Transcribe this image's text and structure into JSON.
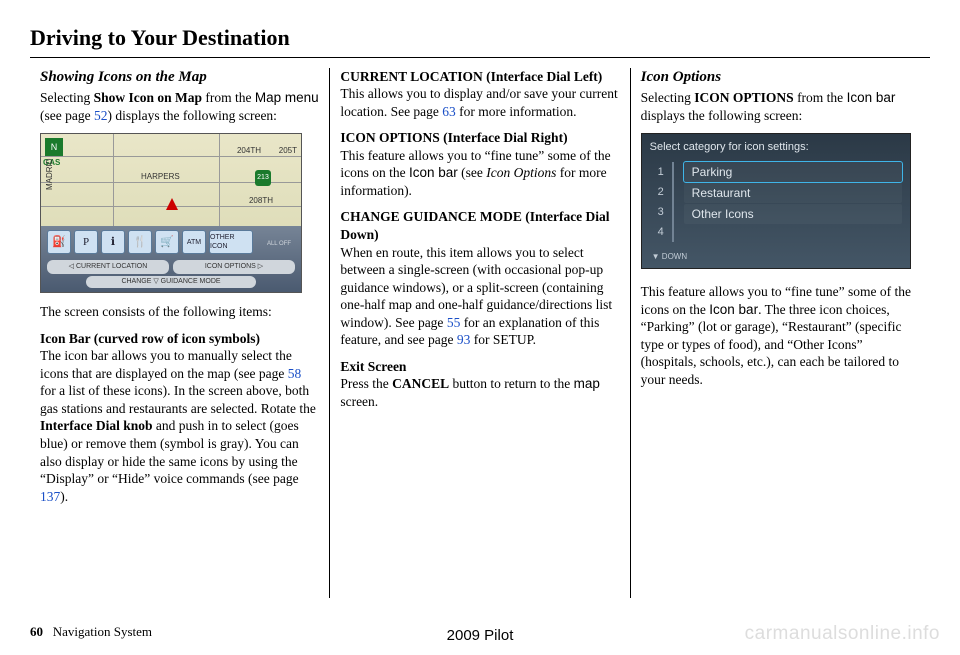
{
  "page_title": "Driving to Your Destination",
  "col1": {
    "subhead": "Showing Icons on the Map",
    "intro_pre": "Selecting ",
    "intro_bold": "Show Icon on Map",
    "intro_mid": " from the ",
    "intro_sans": "Map menu",
    "intro_post1": " (see page ",
    "intro_link": "52",
    "intro_post2": ") displays the following screen:",
    "map": {
      "compass": "N",
      "gas": "GAS",
      "street1": "204TH",
      "street2": "205T",
      "street3": "HARPERS",
      "street4": "208TH",
      "street5": "MADRID",
      "shield": "213",
      "other_icon": "OTHER ICON",
      "all_off": "ALL OFF",
      "pill_left": "CURRENT LOCATION",
      "pill_right": "ICON OPTIONS",
      "change": "CHANGE ▽ GUIDANCE MODE"
    },
    "after_img": "The screen consists of the following items:",
    "iconbar_head": "Icon Bar (curved row of icon symbols)",
    "iconbar_body_a": "The icon bar allows you to manually select the icons that are displayed on the map (see page ",
    "iconbar_link": "58",
    "iconbar_body_b": " for a list of these icons). In the screen above, both gas stations and restaurants are selected. Rotate the ",
    "iconbar_bold": "Interface Dial knob",
    "iconbar_body_c": " and push in to select (goes blue) or remove them (symbol is gray). You can also display or hide the same icons by using the “Display” or “Hide” voice commands (see page ",
    "iconbar_link2": "137",
    "iconbar_body_d": ")."
  },
  "col2": {
    "h1": "CURRENT LOCATION (Interface Dial Left)",
    "p1a": "This allows you to display and/or save your current location. See page ",
    "p1link": "63",
    "p1b": " for more information.",
    "h2": "ICON OPTIONS (Interface Dial Right)",
    "p2a": "This feature allows you to “fine tune” some of the icons on the ",
    "p2sans": "Icon bar",
    "p2b": " (see ",
    "p2ital": "Icon Options",
    "p2c": " for more information).",
    "h3": "CHANGE GUIDANCE MODE (Interface Dial Down)",
    "p3a": "When en route, this item allows you to select between a single-screen (with occasional pop-up guidance windows), or a split-screen (containing one-half map and one-half guidance/directions list window). See page ",
    "p3link1": "55",
    "p3b": " for an explanation of this feature, and see page ",
    "p3link2": "93",
    "p3c": " for SETUP.",
    "h4": "Exit Screen",
    "p4a": "Press the ",
    "p4bold": "CANCEL",
    "p4b": " button to return to the ",
    "p4sans": "map",
    "p4c": " screen."
  },
  "col3": {
    "subhead": "Icon Options",
    "intro_pre": "Selecting ",
    "intro_bold": "ICON OPTIONS",
    "intro_mid": " from the ",
    "intro_sans": "Icon bar",
    "intro_post": " displays the following screen:",
    "screen2_title": "Select category for icon settings:",
    "options": [
      "Parking",
      "Restaurant",
      "Other Icons"
    ],
    "nums": [
      "1",
      "2",
      "3",
      "4"
    ],
    "down": "DOWN",
    "body_a": "This feature allows you to “fine tune” some of the icons on the ",
    "body_sans": "Icon bar",
    "body_b": ". The three icon choices, “Parking” (lot or garage), “Restaurant” (specific type or types of food), and “Other Icons” (hospitals, schools, etc.), can each be tailored to your needs."
  },
  "footer": {
    "page_num": "60",
    "section": "Navigation System",
    "model": "2009  Pilot",
    "watermark": "carmanualsonline.info"
  }
}
